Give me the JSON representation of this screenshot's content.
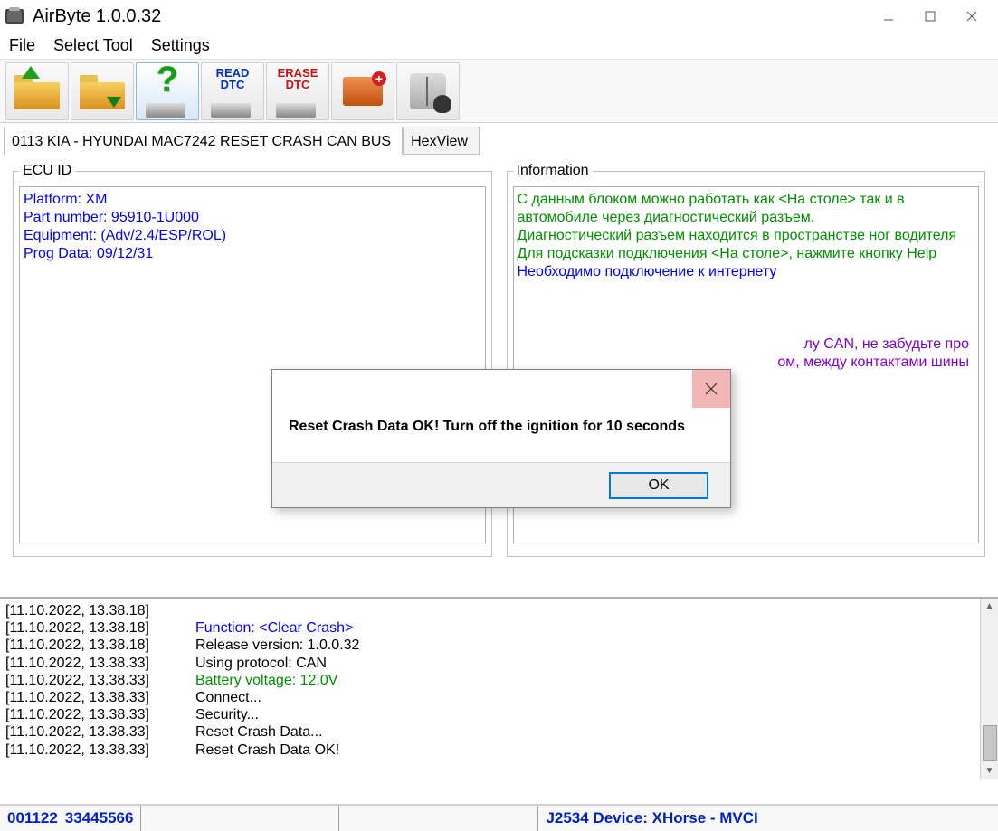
{
  "titlebar": {
    "title": "AirByte  1.0.0.32"
  },
  "menu": {
    "file": "File",
    "selectTool": "Select Tool",
    "settings": "Settings"
  },
  "toolbar": {
    "open": "open",
    "save": "save",
    "help": "help",
    "readDtc1": "READ",
    "readDtc2": "DTC",
    "eraseDtc1": "ERASE",
    "eraseDtc2": "DTC",
    "addChip": "add-chip",
    "manual": "manual"
  },
  "tabs": {
    "main": "0113 KIA - HYUNDAI MAC7242 RESET CRASH CAN BUS",
    "hex": "HexView"
  },
  "ecu": {
    "legend": "ECU ID",
    "l1": "Platform: XM",
    "l2": "Part number: 95910-1U000",
    "l3": "Equipment: (Adv/2.4/ESP/ROL)",
    "l4": "Prog Data: 09/12/31"
  },
  "info": {
    "legend": "Information",
    "l1": "С данным блоком можно работать как <На столе> так и в автомобиле через диагностический разъем.",
    "l2": "Диагностический разъем находится в пространстве ног водителя",
    "l3": "Для подсказки подключения <На столе>, нажмите кнопку Help",
    "l4": "Необходимо подключение к интернету",
    "p5a": "лу CAN, не забудьте про",
    "p5b": "ом, между контактами шины"
  },
  "dialog": {
    "message": "Reset Crash Data OK! Turn off the ignition for 10 seconds",
    "ok": "OK"
  },
  "log": [
    {
      "ts": "[11.10.2022, 13.38.18]",
      "msg": "",
      "cls": ""
    },
    {
      "ts": "[11.10.2022, 13.38.18]",
      "msg": "Function: <Clear Crash>",
      "cls": "log-blue"
    },
    {
      "ts": "[11.10.2022, 13.38.18]",
      "msg": "Release version: 1.0.0.32",
      "cls": ""
    },
    {
      "ts": "[11.10.2022, 13.38.33]",
      "msg": "Using protocol: CAN",
      "cls": ""
    },
    {
      "ts": "[11.10.2022, 13.38.33]",
      "msg": "Battery voltage: 12,0V",
      "cls": "log-green"
    },
    {
      "ts": "[11.10.2022, 13.38.33]",
      "msg": "Connect...",
      "cls": ""
    },
    {
      "ts": "[11.10.2022, 13.38.33]",
      "msg": "Security...",
      "cls": ""
    },
    {
      "ts": "[11.10.2022, 13.38.33]",
      "msg": "Reset Crash Data...",
      "cls": ""
    },
    {
      "ts": "[11.10.2022, 13.38.33]",
      "msg": "Reset Crash Data OK!",
      "cls": ""
    }
  ],
  "status": {
    "code1": "001122",
    "code2": "33445566",
    "device": "J2534 Device: XHorse - MVCI"
  }
}
